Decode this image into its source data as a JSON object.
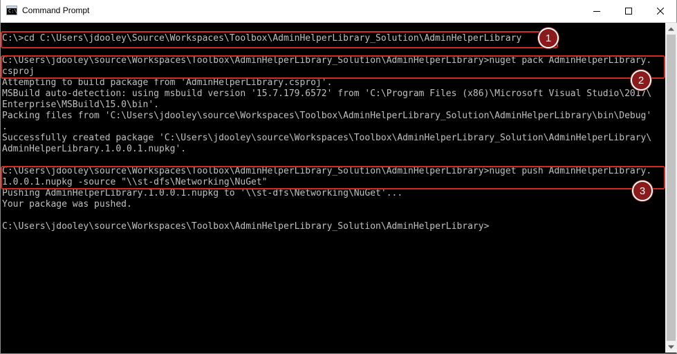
{
  "window": {
    "title": "Command Prompt",
    "icon": "cmd-icon",
    "icon_glyph": "C:\\",
    "controls": [
      "minimize-icon",
      "maximize-icon",
      "close-icon"
    ]
  },
  "console": {
    "colors": {
      "background": "#000000",
      "text": "#c0c0c0",
      "highlight": "#d12a2a",
      "callout": "#8b1a1a"
    },
    "lines": [
      "C:\\>cd C:\\Users\\jdooley\\Source\\Workspaces\\Toolbox\\AdminHelperLibrary_Solution\\AdminHelperLibrary",
      "",
      "C:\\Users\\jdooley\\source\\Workspaces\\Toolbox\\AdminHelperLibrary_Solution\\AdminHelperLibrary>nuget pack AdminHelperLibrary.",
      "csproj",
      "Attempting to build package from 'AdminHelperLibrary.csproj'.",
      "MSBuild auto-detection: using msbuild version '15.7.179.6572' from 'C:\\Program Files (x86)\\Microsoft Visual Studio\\2017\\",
      "Enterprise\\MSBuild\\15.0\\bin'.",
      "Packing files from 'C:\\Users\\jdooley\\source\\Workspaces\\Toolbox\\AdminHelperLibrary_Solution\\AdminHelperLibrary\\bin\\Debug'",
      ".",
      "Successfully created package 'C:\\Users\\jdooley\\source\\Workspaces\\Toolbox\\AdminHelperLibrary_Solution\\AdminHelperLibrary\\",
      "AdminHelperLibrary.1.0.0.1.nupkg'.",
      "",
      "C:\\Users\\jdooley\\source\\Workspaces\\Toolbox\\AdminHelperLibrary_Solution\\AdminHelperLibrary>nuget push AdminHelperLibrary.",
      "1.0.0.1.nupkg -source \"\\\\st-dfs\\Networking\\NuGet\"",
      "Pushing AdminHelperLibrary.1.0.0.1.nupkg to '\\\\st-dfs\\Networking\\NuGet'...",
      "Your package was pushed.",
      "",
      "C:\\Users\\jdooley\\source\\Workspaces\\Toolbox\\AdminHelperLibrary_Solution\\AdminHelperLibrary>"
    ]
  },
  "callouts": [
    "1",
    "2",
    "3"
  ]
}
